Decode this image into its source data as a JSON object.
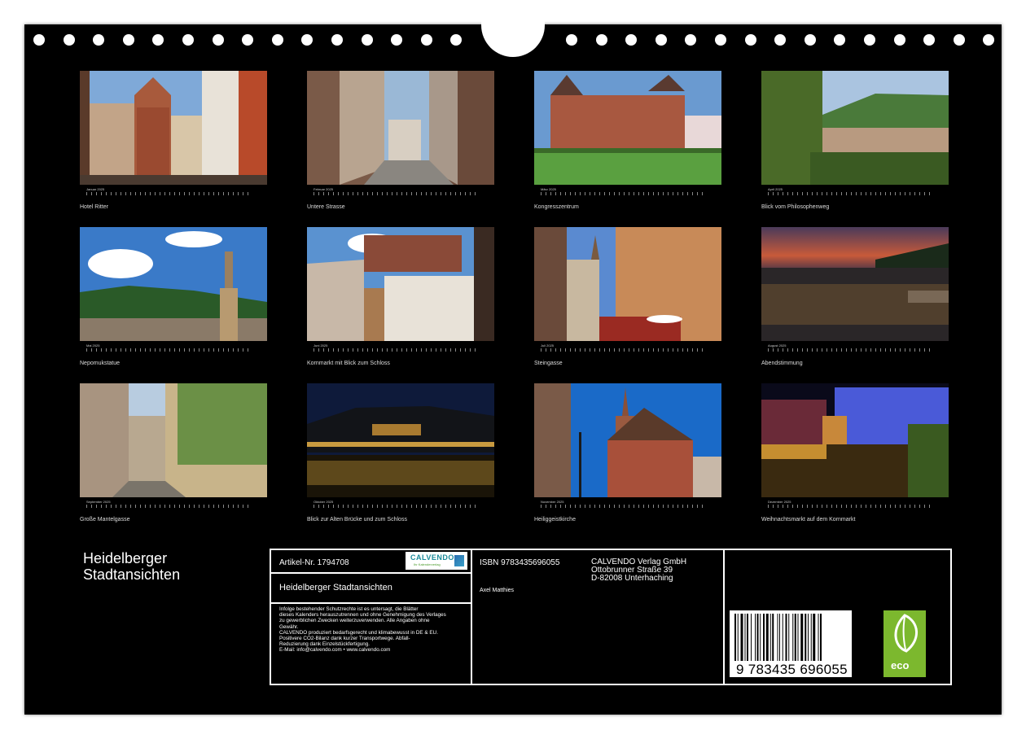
{
  "months": [
    {
      "month": "Januar 2025",
      "caption": "Hotel Ritter"
    },
    {
      "month": "Februar 2025",
      "caption": "Untere Strasse"
    },
    {
      "month": "März 2025",
      "caption": "Kongresszentrum"
    },
    {
      "month": "April 2025",
      "caption": "Blick vom Philosophenweg"
    },
    {
      "month": "Mai 2025",
      "caption": "Nepomukstatue"
    },
    {
      "month": "Juni 2025",
      "caption": "Kornmarkt mit Blick zum Schloss"
    },
    {
      "month": "Juli 2025",
      "caption": "Steingasse"
    },
    {
      "month": "August 2025",
      "caption": "Abendstimmung"
    },
    {
      "month": "September 2025",
      "caption": "Große Mantelgasse"
    },
    {
      "month": "Oktober 2025",
      "caption": "Blick zur Alten Brücke und zum Schloss"
    },
    {
      "month": "November 2025",
      "caption": "Heiliggeistkirche"
    },
    {
      "month": "Dezember 2025",
      "caption": "Weihnachtsmarkt auf dem Kornmarkt"
    }
  ],
  "title_line1": "Heidelberger",
  "title_line2": "Stadtansichten",
  "imprint": {
    "article": "Artikel-Nr. 1794708",
    "logo_text": "CALVENDO",
    "logo_sub": "Ihr Kalenderverlag",
    "calendar_title": "Heidelberger Stadtansichten",
    "legal": [
      "Infolge bestehender Schutzrechte ist es untersagt, die Blätter",
      "dieses Kalenders herauszutrennen und ohne Genehmigung des Verlages",
      "zu gewerblichen Zwecken weiterzuverwenden. Alle Angaben ohne",
      "Gewähr.",
      "CALVENDO produziert bedarfsgerecht und klimabewusst in DE & EU.",
      "Positivere CO2-Bilanz dank kurzer Transportwege. Abfall-",
      "Reduzierung dank Einzelstückfertigung.",
      "E-Mail: info@calvendo.com • www.calvendo.com"
    ],
    "isbn": "ISBN 9783435696055",
    "author": "Axel Matthies",
    "publisher": [
      "CALVENDO Verlag GmbH",
      "Ottobrunner Straße 39",
      "D-82008 Unterhaching"
    ],
    "barcode_number": "9  783435  696055",
    "eco_label": "eco"
  }
}
